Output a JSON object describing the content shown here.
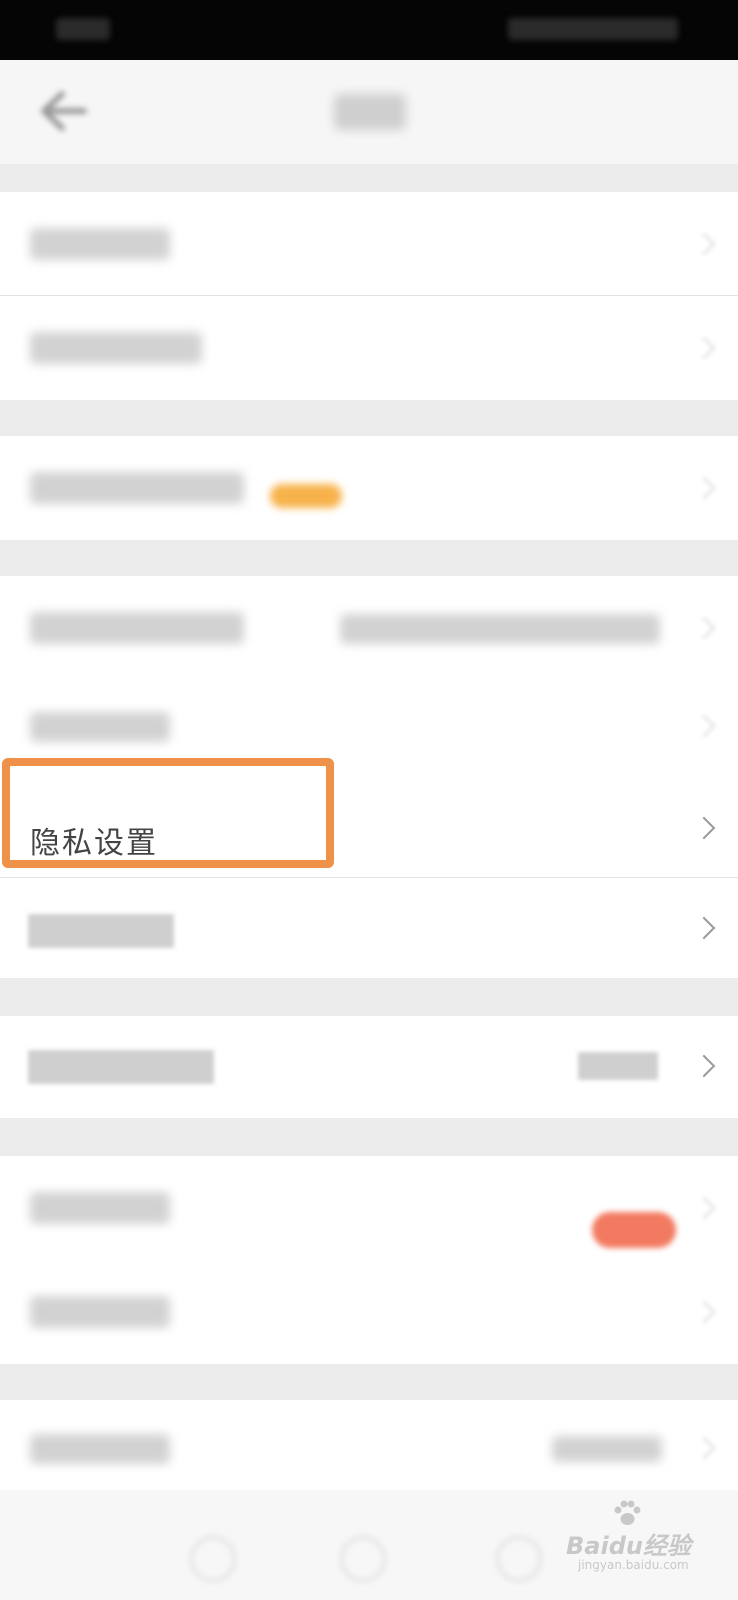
{
  "settings": {
    "privacy_item_label": "隐私设置"
  },
  "watermark": {
    "brand": "Baidu经验",
    "domain": "jingyan.baidu.com"
  },
  "colors": {
    "highlight": "#f0914a",
    "badge": "#f7b24a",
    "pill": "#f27a61"
  },
  "icons": [
    "back-arrow-icon",
    "chevron-right-icon",
    "baidu-paw-icon"
  ]
}
